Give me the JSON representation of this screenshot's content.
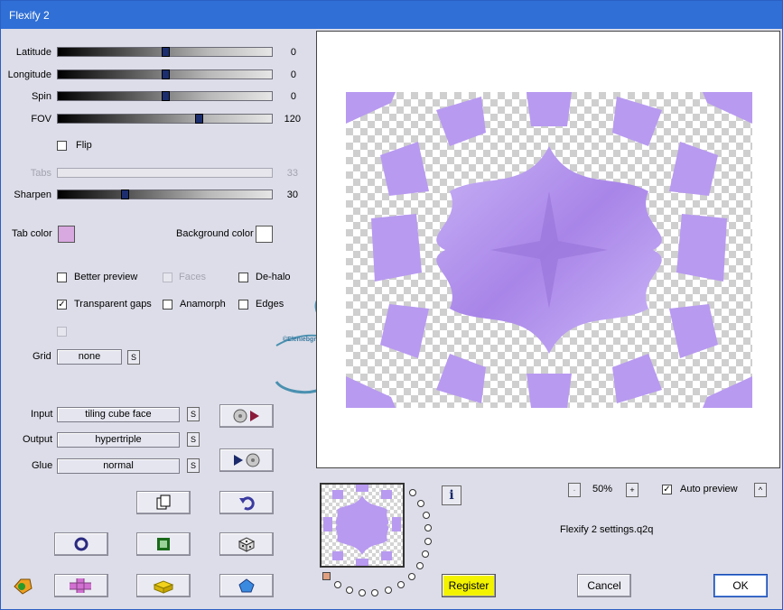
{
  "window": {
    "title": "Flexify 2"
  },
  "sliders": [
    {
      "label": "Latitude",
      "value": "0",
      "position": 0.5
    },
    {
      "label": "Longitude",
      "value": "0",
      "position": 0.5
    },
    {
      "label": "Spin",
      "value": "0",
      "position": 0.5
    },
    {
      "label": "FOV",
      "value": "120",
      "position": 0.66
    },
    {
      "label": "Tabs",
      "value": "33",
      "disabled": true
    },
    {
      "label": "Sharpen",
      "value": "30",
      "position": 0.3
    }
  ],
  "checkboxes": {
    "flip": {
      "label": "Flip",
      "checked": false
    },
    "better_preview": {
      "label": "Better preview",
      "checked": false
    },
    "faces": {
      "label": "Faces",
      "checked": false,
      "disabled": true
    },
    "de_halo": {
      "label": "De-halo",
      "checked": false
    },
    "transparent_gaps": {
      "label": "Transparent gaps",
      "checked": true
    },
    "anamorph": {
      "label": "Anamorph",
      "checked": false
    },
    "edges": {
      "label": "Edges",
      "checked": false
    },
    "auto_preview": {
      "label": "Auto preview",
      "checked": true
    }
  },
  "colors": {
    "tab_color_label": "Tab color",
    "tab_color": "#d8a8e0",
    "background_color_label": "Background color",
    "background_color": "#ffffff",
    "accent_purple": "#b89af0"
  },
  "grid": {
    "label": "Grid",
    "value": "none",
    "s_label": "S"
  },
  "projection": {
    "input_label": "Input",
    "input_value": "tiling cube face",
    "output_label": "Output",
    "output_value": "hypertriple",
    "glue_label": "Glue",
    "glue_value": "normal",
    "s_label": "S"
  },
  "zoom": {
    "minus": "-",
    "value": "50%",
    "plus": "+"
  },
  "caret_label": "^",
  "info_label": "i",
  "settings_file": "Flexify 2 settings.q2q",
  "buttons": {
    "register": "Register",
    "cancel": "Cancel",
    "ok": "OK"
  },
  "icons": [
    "disc-to-play-icon",
    "play-to-disc-icon",
    "copy-icon",
    "undo-icon",
    "circle-icon",
    "square-frame-icon",
    "dice-icon",
    "plugin-logo-icon",
    "cross-icon",
    "lego-brick-icon",
    "pentagon-icon",
    "info-icon"
  ],
  "watermark": "©Eleniebgrafhu Vison"
}
